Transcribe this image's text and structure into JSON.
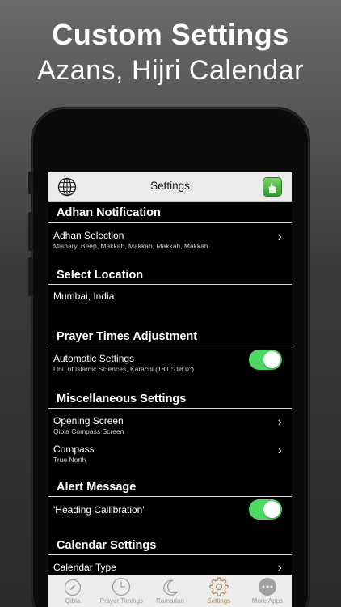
{
  "promo": {
    "title": "Custom Settings",
    "subtitle": "Azans, Hijri Calendar"
  },
  "navbar": {
    "title": "Settings",
    "left_icon": "globe-icon",
    "right_icon": "app-icon"
  },
  "sections": {
    "adhan": {
      "header": "Adhan Notification",
      "selection_label": "Adhan Selection",
      "selection_value": "Mishary, Beep, Makkah, Makkah, Makkah, Makkah"
    },
    "location": {
      "header": "Select Location",
      "value": "Mumbai, India"
    },
    "adjust": {
      "header": "Prayer Times Adjustment",
      "auto_label": "Automatic Settings",
      "auto_sub": "Uni. of Islamic Sciences, Karachi (18.0°/18.0°)",
      "auto_on": true
    },
    "misc": {
      "header": "Miscellaneous Settings",
      "opening_label": "Opening Screen",
      "opening_value": "Qibla Compass Screen",
      "compass_label": "Compass",
      "compass_value": "True North"
    },
    "alert": {
      "header": "Alert Message",
      "heading_label": "'Heading Callibration'",
      "heading_on": true
    },
    "calendar": {
      "header": "Calendar Settings",
      "type_label": "Calendar Type"
    }
  },
  "tabs": [
    {
      "label": "Qibla",
      "icon": "compass-icon",
      "active": false
    },
    {
      "label": "Prayer Timings",
      "icon": "clock-icon",
      "active": false
    },
    {
      "label": "Ramadan",
      "icon": "crescent-moon-icon",
      "active": false
    },
    {
      "label": "Settings",
      "icon": "gear-icon",
      "active": true
    },
    {
      "label": "More Apps",
      "icon": "more-dots-icon",
      "active": false
    }
  ],
  "colors": {
    "toggle_on": "#4cd964",
    "active_tab": "#b08a5a",
    "inactive_tab": "#9a9a9a"
  }
}
